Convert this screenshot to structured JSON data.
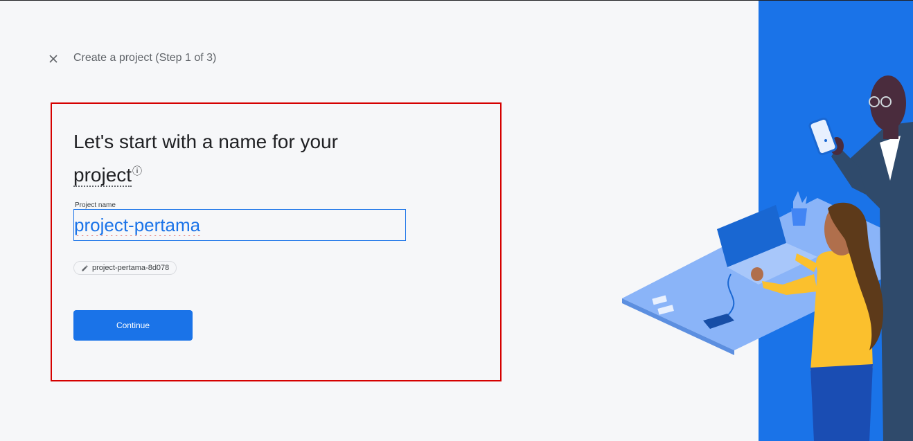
{
  "header": {
    "close_icon": "close-icon",
    "step_title": "Create a project (Step 1 of 3)"
  },
  "main": {
    "heading_part1": "Let's start with a name for your ",
    "heading_link": "project",
    "help_icon": "help-circle-icon",
    "project_name_label": "Project name",
    "project_name_value": "project-pertama",
    "project_id_chip": "project-pertama-8d078",
    "edit_icon": "pencil-icon",
    "continue_label": "Continue"
  },
  "colors": {
    "accent": "#1a73e8",
    "illustration_bg": "#1a73e8",
    "highlight_frame": "#d50000",
    "background": "#f6f7f9"
  }
}
